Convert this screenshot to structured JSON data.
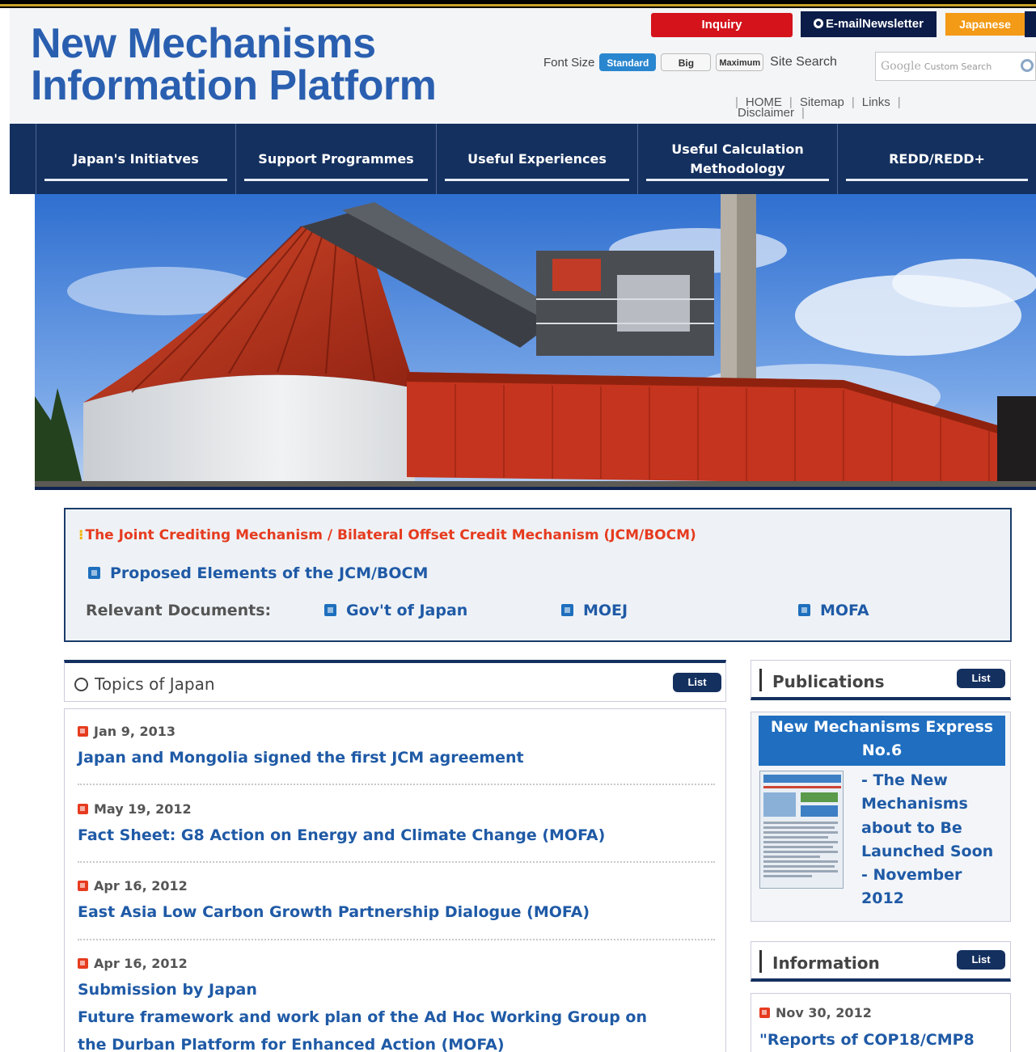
{
  "header": {
    "logo_line1": "New Mechanisms",
    "logo_line2": "Information Platform",
    "inquiry_label": "Inquiry",
    "newsletter_label": "E-mailNewsletter",
    "japanese_label": "Japanese",
    "font_size_label": "Font Size",
    "font_sizes": [
      "Standard",
      "Big",
      "Maximum"
    ],
    "site_search_label": "Site Search",
    "search_placeholder_brand": "Google",
    "search_placeholder_text": "Custom Search",
    "util_links": [
      "HOME",
      "Sitemap",
      "Links",
      "Disclaimer"
    ]
  },
  "nav": {
    "items": [
      "Japan's Initiatves",
      "Support Programmes",
      "Useful Experiences",
      "Useful Calculation Methodology",
      "REDD/REDD+"
    ]
  },
  "jcm": {
    "title": "The Joint Crediting Mechanism / Bilateral Offset Credit Mechanism (JCM/BOCM)",
    "proposed": "Proposed Elements of the JCM/BOCM",
    "relevant_label": "Relevant Documents:",
    "docs": [
      "Gov't of Japan",
      "MOEJ",
      "MOFA"
    ]
  },
  "topics": {
    "title": "Topics of Japan",
    "list_label": "List",
    "items": [
      {
        "date": "Jan 9, 2013",
        "title": "Japan and Mongolia signed the first JCM agreement"
      },
      {
        "date": "May 19, 2012",
        "title": "Fact Sheet: G8 Action on Energy and Climate Change (MOFA)"
      },
      {
        "date": "Apr 16, 2012",
        "title": "East Asia Low Carbon Growth Partnership Dialogue (MOFA)"
      },
      {
        "date": "Apr 16, 2012",
        "title": "Submission by Japan",
        "title2": "Future framework and work plan of the Ad Hoc Working Group on",
        "title3": "the Durban Platform for Enhanced Action (MOFA)"
      }
    ]
  },
  "publications": {
    "title": "Publications",
    "list_label": "List",
    "express_line1": "New Mechanisms Express",
    "express_line2": "No.6",
    "desc_lines": [
      "- The New",
      "Mechanisms",
      "about to Be",
      "Launched Soon",
      "- November",
      "2012"
    ]
  },
  "information": {
    "title": "Information",
    "list_label": "List",
    "date": "Nov 30, 2012",
    "title_text": "\"Reports of COP18/CMP8"
  }
}
